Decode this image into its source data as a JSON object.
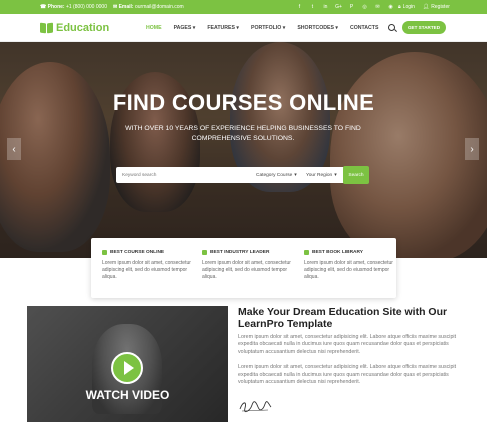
{
  "topbar": {
    "phone_label": "Phone:",
    "phone": "+1 (800) 000 0000",
    "email_label": "Email:",
    "email": "ourmail@domain.com",
    "socials": [
      "f",
      "t",
      "in",
      "G+",
      "P",
      "◎",
      "✉",
      "◉"
    ],
    "login_label": "Login",
    "register_label": "Register"
  },
  "nav": {
    "brand": "Education",
    "items": [
      {
        "label": "HOME"
      },
      {
        "label": "PAGES ▾"
      },
      {
        "label": "FEATURES ▾"
      },
      {
        "label": "PORTFOLIO ▾"
      },
      {
        "label": "SHORTCODES ▾"
      },
      {
        "label": "CONTACTS"
      }
    ],
    "cta": "GET STARTED"
  },
  "hero": {
    "headline": "FIND COURSES ONLINE",
    "subtitle": "WITH OVER 10 YEARS OF EXPERIENCE HELPING BUSINESSES TO FIND COMPREHENSIVE SOLUTIONS.",
    "prev": "‹",
    "next": "›"
  },
  "search": {
    "placeholder": "Keyword search",
    "category": "Category Course",
    "region": "Your Region",
    "button": "Search"
  },
  "features": [
    {
      "title": "BEST COURSE ONLINE",
      "text": "Lorem ipsum dolor sit amet, consectetur adipiscing elit, sed do eiusmod tempor aliqua."
    },
    {
      "title": "BEST INDUSTRY LEADER",
      "text": "Lorem ipsum dolor sit amet, consectetur adipiscing elit, sed do eiusmod tempor aliqua."
    },
    {
      "title": "BEST BOOK LIBRARY",
      "text": "Lorem ipsum dolor sit amet, consectetur adipiscing elit, sed do eiusmod tempor aliqua."
    }
  ],
  "video": {
    "label": "WATCH VIDEO"
  },
  "about": {
    "title": "Make Your Dream Education Site with Our LearnPro Template",
    "paragraphs": [
      "Lorem ipsum dolor sit amet, consectetur adipisicing elit. Labore atque officiis maxime suscipit expedita obcaecati nulla in ducimus iure quos quam recusandae dolor quas et perspiciatis voluptatum accusantium delectus nisi reprehenderit.",
      "Lorem ipsum dolor sit amet, consectetur adipisicing elit. Labore atque officiis maxime suscipit expedita obcaecati nulla in ducimus iure quos quam recusandae dolor quas et perspiciatis voluptatum accusantium delectus nisi reprehenderit."
    ]
  },
  "colors": {
    "accent": "#7cc242",
    "heading": "#222222",
    "body": "#777777"
  }
}
